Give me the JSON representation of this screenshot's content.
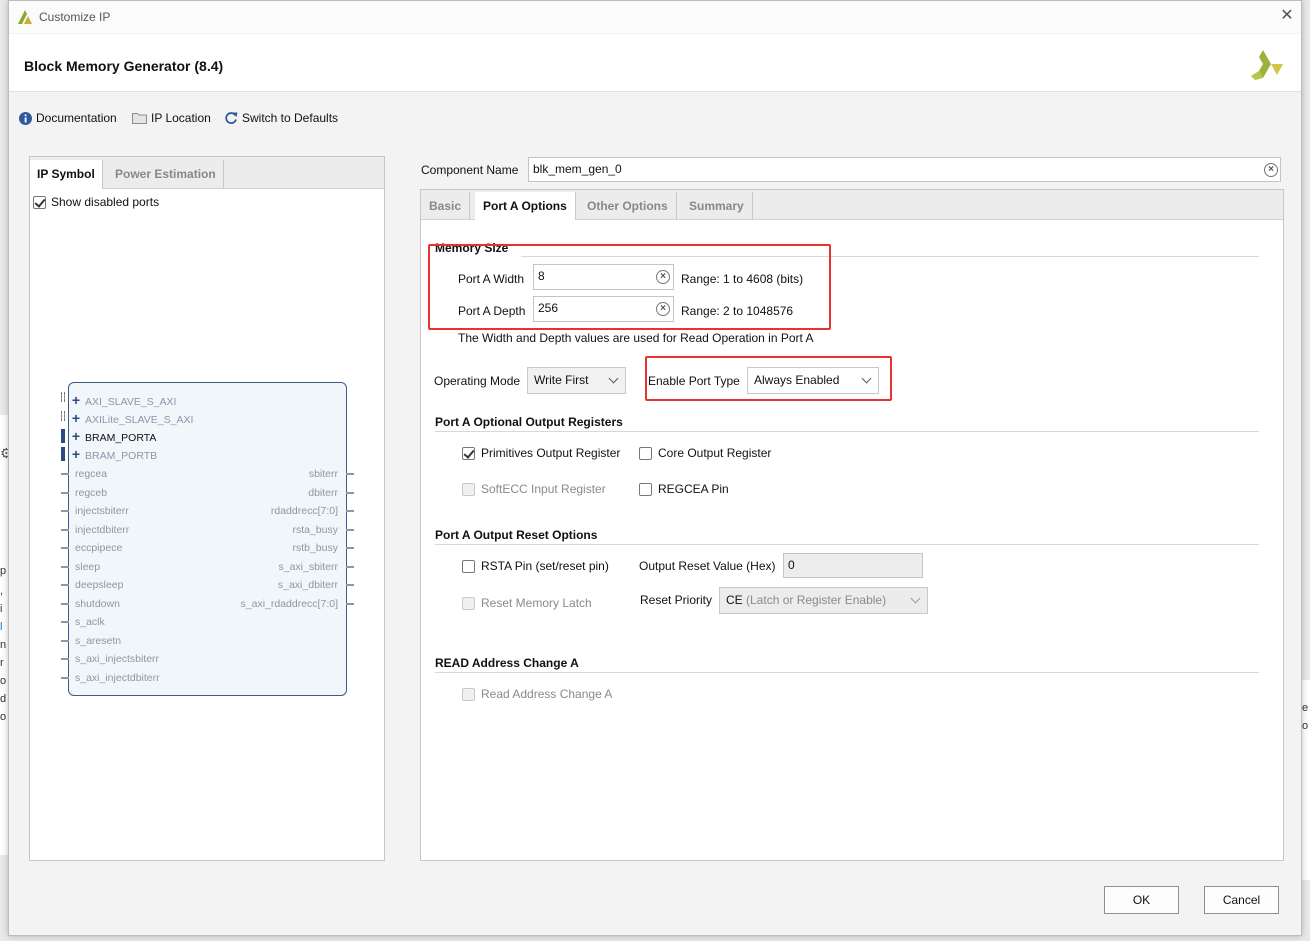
{
  "window": {
    "title": "Customize IP",
    "ip_title": "Block Memory Generator (8.4)"
  },
  "toolbar": {
    "documentation": "Documentation",
    "ip_location": "IP Location",
    "switch_defaults": "Switch to Defaults"
  },
  "left_panel": {
    "tabs": [
      "IP Symbol",
      "Power Estimation"
    ],
    "show_disabled_ports": "Show disabled ports",
    "buses": [
      "AXI_SLAVE_S_AXI",
      "AXILite_SLAVE_S_AXI",
      "BRAM_PORTA",
      "BRAM_PORTB"
    ],
    "left_ports": [
      "regcea",
      "regceb",
      "injectsbiterr",
      "injectdbiterr",
      "eccpipece",
      "sleep",
      "deepsleep",
      "shutdown",
      "s_aclk",
      "s_aresetn",
      "s_axi_injectsbiterr",
      "s_axi_injectdbiterr"
    ],
    "right_ports": [
      "sbiterr",
      "dbiterr",
      "rdaddrecc[7:0]",
      "rsta_busy",
      "rstb_busy",
      "s_axi_sbiterr",
      "s_axi_dbiterr",
      "s_axi_rdaddrecc[7:0]"
    ]
  },
  "component": {
    "label": "Component Name",
    "value": "blk_mem_gen_0"
  },
  "tabs": [
    "Basic",
    "Port A Options",
    "Other Options",
    "Summary"
  ],
  "memory_size": {
    "title": "Memory Size",
    "width_label": "Port A Width",
    "width_value": "8",
    "width_range": "Range: 1 to 4608 (bits)",
    "depth_label": "Port A Depth",
    "depth_value": "256",
    "depth_range": "Range: 2 to 1048576",
    "note": "The Width and Depth values are used for Read Operation in Port A"
  },
  "operating_mode": {
    "label": "Operating Mode",
    "value": "Write First"
  },
  "enable_port": {
    "label": "Enable Port Type",
    "value": "Always Enabled"
  },
  "output_registers": {
    "title": "Port A Optional Output Registers",
    "primitives": "Primitives Output Register",
    "core": "Core Output Register",
    "softecc": "SoftECC Input Register",
    "regcea": "REGCEA Pin"
  },
  "reset_options": {
    "title": "Port A Output Reset Options",
    "rsta": "RSTA Pin (set/reset pin)",
    "reset_value_label": "Output Reset Value (Hex)",
    "reset_value": "0",
    "reset_latch": "Reset Memory Latch",
    "priority_label": "Reset Priority",
    "priority_value_a": "CE",
    "priority_value_b": "(Latch or Register Enable)"
  },
  "read_address": {
    "title": "READ Address Change A",
    "checkbox": "Read Address Change A"
  },
  "buttons": {
    "ok": "OK",
    "cancel": "Cancel"
  },
  "bg_left_letters": [
    "p",
    ",",
    "i",
    "l",
    "n",
    "r",
    "o",
    "d",
    "o"
  ],
  "bg_right_letters": [
    "e",
    "o"
  ],
  "colors": {
    "highlight": "#e8322f",
    "brand": "#9ab43a"
  }
}
